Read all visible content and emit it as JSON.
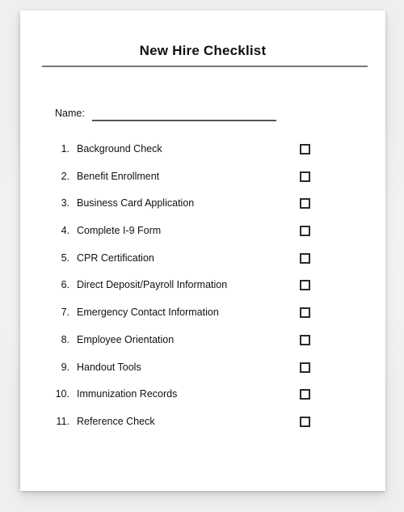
{
  "document": {
    "title": "New Hire Checklist",
    "name_field": {
      "label": "Name:",
      "value": "",
      "placeholder": ""
    },
    "items": [
      {
        "number": "1.",
        "label": "Background Check",
        "checked": false
      },
      {
        "number": "2.",
        "label": "Benefit Enrollment",
        "checked": false
      },
      {
        "number": "3.",
        "label": "Business Card Application",
        "checked": false
      },
      {
        "number": "4.",
        "label": "Complete I-9 Form",
        "checked": false
      },
      {
        "number": "5.",
        "label": "CPR Certification",
        "checked": false
      },
      {
        "number": "6.",
        "label": "Direct Deposit/Payroll Information",
        "checked": false
      },
      {
        "number": "7.",
        "label": "Emergency Contact Information",
        "checked": false
      },
      {
        "number": "8.",
        "label": "Employee Orientation",
        "checked": false
      },
      {
        "number": "9.",
        "label": "Handout Tools",
        "checked": false
      },
      {
        "number": "10.",
        "label": "Immunization Records",
        "checked": false
      },
      {
        "number": "11.",
        "label": "Reference Check",
        "checked": false
      }
    ]
  },
  "colors": {
    "page_background": "#ffffff",
    "canvas_background": "#f4f4f4",
    "text": "#111111",
    "title_rule": "#76777a",
    "name_rule": "#555559",
    "checkbox_border": "#2b2b2b"
  }
}
